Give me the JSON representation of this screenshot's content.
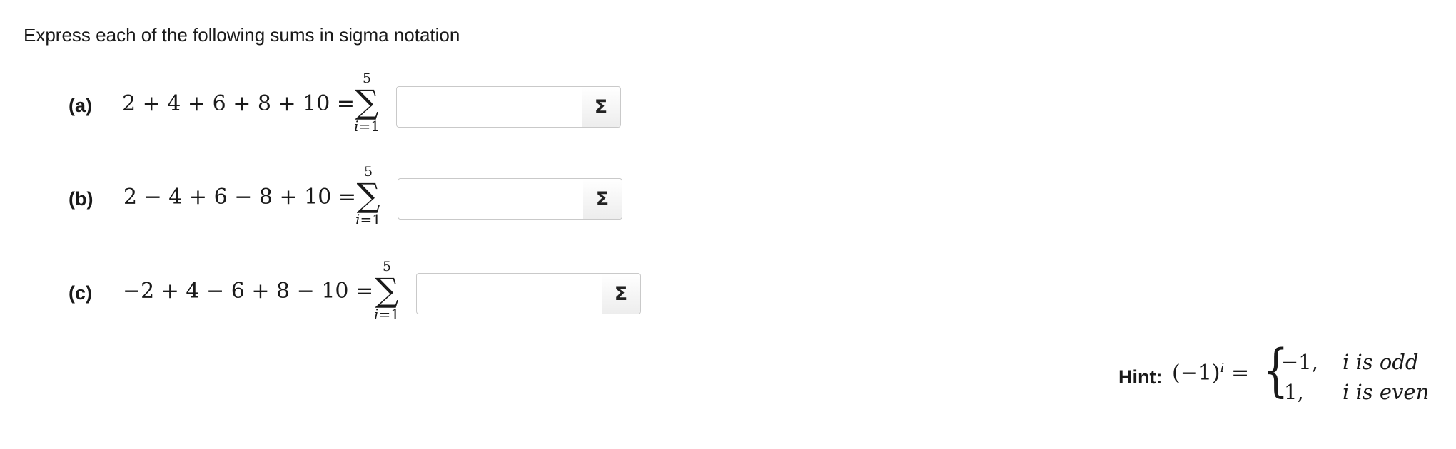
{
  "instruction": "Express each of the following sums in sigma notation",
  "problems": [
    {
      "label": "(a)",
      "lhs": "2 + 4 + 6 + 8 + 10 =",
      "upper": "5",
      "lower_var": "i",
      "lower_rest": "=1",
      "answer_value": "",
      "button_label": "Σ"
    },
    {
      "label": "(b)",
      "lhs": "2 − 4 + 6 − 8 + 10 =",
      "upper": "5",
      "lower_var": "i",
      "lower_rest": "=1",
      "answer_value": "",
      "button_label": "Σ"
    },
    {
      "label": "(c)",
      "lhs": "−2 + 4 − 6 + 8 − 10 =",
      "upper": "5",
      "lower_var": "i",
      "lower_rest": "=1",
      "answer_value": "",
      "button_label": "Σ"
    }
  ],
  "hint": {
    "label": "Hint:",
    "base": "(−1)",
    "exponent": "i",
    "equals": "=",
    "brace": "{",
    "case1_value": "−1,",
    "case1_condition": "i is odd",
    "case2_value": "1,",
    "case2_condition": "i is even"
  },
  "sigma_symbol": "∑"
}
